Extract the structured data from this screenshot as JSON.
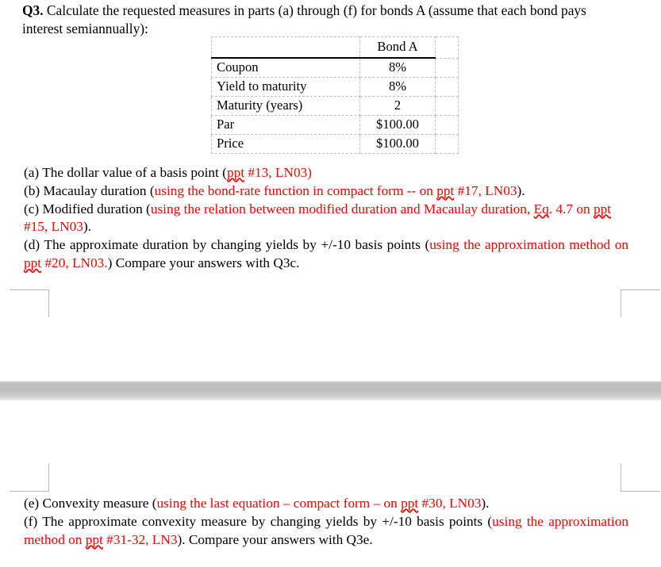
{
  "document": {
    "question": {
      "label": "Q3.",
      "text": " Calculate the requested measures in parts (a) through (f) for bonds A (assume that each bond pays interest semiannually):"
    },
    "bond_table": {
      "header": [
        "",
        "Bond A",
        ""
      ],
      "rows": [
        {
          "label": "Coupon",
          "value": "8%",
          "pad": ""
        },
        {
          "label": "Yield to maturity",
          "value": "8%",
          "pad": ""
        },
        {
          "label": "Maturity (years)",
          "value": "2",
          "pad": ""
        },
        {
          "label": "Par",
          "value": "$100.00",
          "pad": ""
        },
        {
          "label": "Price",
          "value": "$100.00",
          "pad": ""
        }
      ]
    },
    "parts_top": [
      {
        "id": "a",
        "black_1": "(a) The dollar value of a basis point (",
        "red_word_1": "ppt",
        "red_2": " #13, LN03)",
        "black_3": ""
      },
      {
        "id": "b",
        "black_1": "(b) Macaulay duration (",
        "red_1": "using the bond-rate function in compact form -- on ",
        "red_word_1": "ppt",
        "red_2": " #17, LN03",
        "black_3": ")."
      },
      {
        "id": "c",
        "black_1": "(c) Modified duration (",
        "red_1": "using the relation between modified duration and Macaulay duration, ",
        "red_word_1": "Eq",
        "red_mid": ". 4.7 on ",
        "red_word_2": "ppt",
        "red_2": " #15, LN03",
        "black_3": ")."
      },
      {
        "id": "d",
        "black_1": "(d) The approximate duration by changing yields by +/-10 basis points (",
        "red_1": "using the approximation method on ",
        "red_word_1": "ppt",
        "red_2": " #20, LN03.",
        "black_3": ") Compare your answers with Q3c."
      }
    ],
    "parts_bottom": [
      {
        "id": "e",
        "black_1": "(e) Convexity measure (",
        "red_1": "using the last equation – compact form – on ",
        "red_word_1": "ppt",
        "red_2": " #30, LN03",
        "black_3": ")."
      },
      {
        "id": "f",
        "black_1": "(f) The approximate convexity measure by changing yields by +/-10 basis points (",
        "red_1": "using the approximation method on ",
        "red_word_1": "ppt",
        "red_2": " #31-32, LN3",
        "black_3": "). Compare your answers with Q3e."
      }
    ],
    "colors": {
      "annotation_red": "#ff0000",
      "text_black": "#000000",
      "table_grid": "#bfbfbf",
      "crop_mark": "#b8b8b8",
      "page_gap": "#bdbdbd"
    }
  }
}
